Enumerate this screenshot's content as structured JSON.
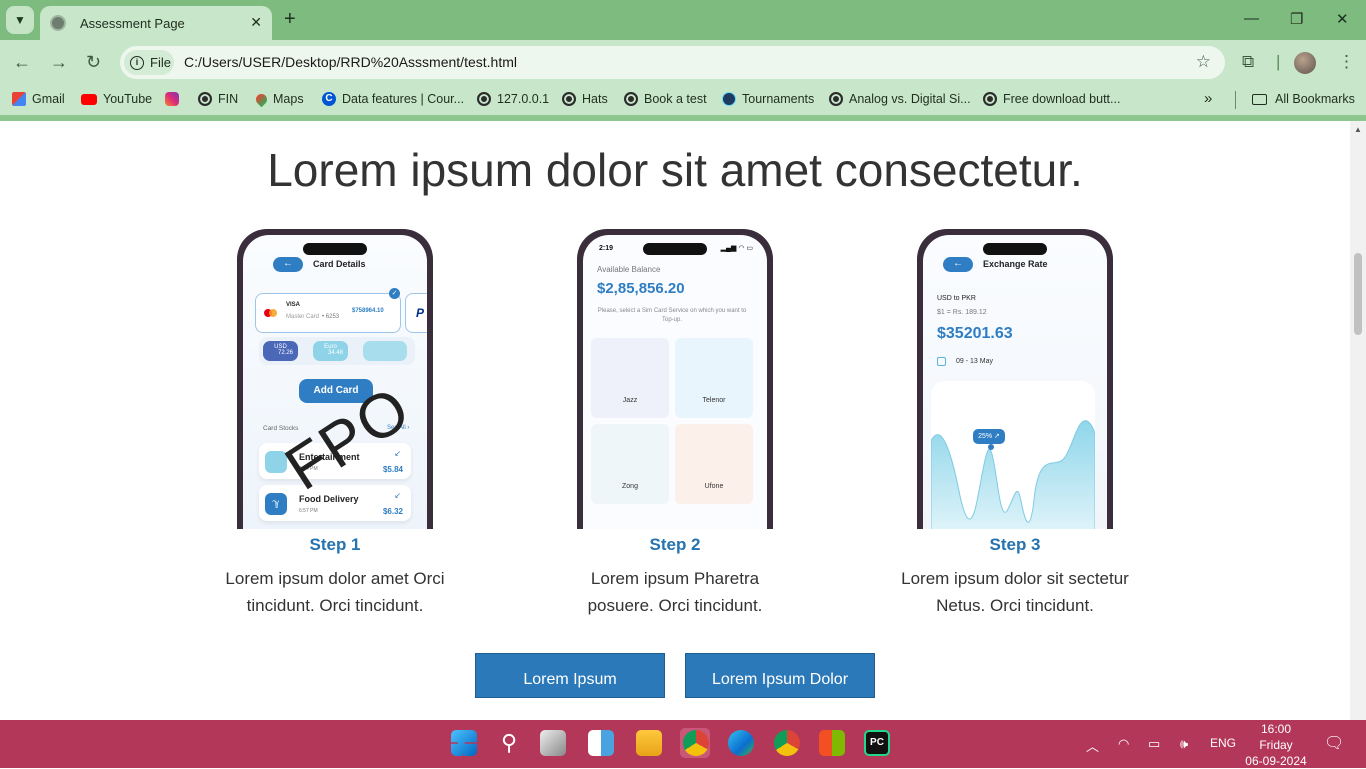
{
  "browser": {
    "tab_title": "Assessment Page",
    "new_tab": "+",
    "file_chip": "File",
    "url": "C:/Users/USER/Desktop/RRD%20Asssment/test.html",
    "bookmarks": [
      {
        "label": "Gmail",
        "icon": "gmail-icon"
      },
      {
        "label": "YouTube",
        "icon": "youtube-icon"
      },
      {
        "label": "",
        "icon": "instagram-icon"
      },
      {
        "label": "FIN",
        "icon": "globe-icon"
      },
      {
        "label": "Maps",
        "icon": "maps-icon"
      },
      {
        "label": "Data features | Cour...",
        "icon": "coursera-icon"
      },
      {
        "label": "127.0.0.1",
        "icon": "globe-icon"
      },
      {
        "label": "Hats",
        "icon": "globe-icon"
      },
      {
        "label": "Book a test",
        "icon": "globe-icon"
      },
      {
        "label": "Tournaments",
        "icon": "react-icon"
      },
      {
        "label": "Analog vs. Digital Si...",
        "icon": "globe-icon"
      },
      {
        "label": "Free download butt...",
        "icon": "globe-icon"
      }
    ],
    "more_bookmarks": "»",
    "all_bookmarks": "All Bookmarks"
  },
  "page": {
    "heading": "Lorem ipsum dolor sit amet consectetur.",
    "steps": [
      {
        "title": "Step 1",
        "desc_line1": "Lorem ipsum dolor amet Orci",
        "desc_line2": "tincidunt. Orci tincidunt."
      },
      {
        "title": "Step 2",
        "desc_line1": "Lorem ipsum Pharetra",
        "desc_line2": "posuere. Orci tincidunt."
      },
      {
        "title": "Step 3",
        "desc_line1": "Lorem ipsum dolor sit sectetur",
        "desc_line2": "Netus. Orci tincidunt."
      }
    ],
    "buttons": {
      "primary": "Lorem Ipsum",
      "secondary": "Lorem Ipsum Dolor"
    }
  },
  "phone1": {
    "title": "Card Details",
    "card_brand": "VISA",
    "card_type": "Master Card",
    "card_number": "• 6253",
    "card_amount": "$758964.10",
    "currencies": [
      {
        "code": "USD",
        "value": "72.26"
      },
      {
        "code": "Euro",
        "value": "34.48"
      },
      {
        "code": "",
        "value": ""
      }
    ],
    "add_card": "Add Card",
    "section_label": "Card Stocks",
    "see_all": "See All ›",
    "watermark": "FPO",
    "transactions": [
      {
        "name": "Entertainment",
        "time": "4:34 PM",
        "amount": "$5.84"
      },
      {
        "name": "Food Delivery",
        "time": "6:57 PM",
        "amount": "$6.32"
      }
    ]
  },
  "phone2": {
    "time": "2:19",
    "label": "Available Balance",
    "balance": "$2,85,856.20",
    "note": "Please, select a Sim Card Service on which you want to Top-up.",
    "sims": [
      "Jazz",
      "Telenor",
      "Zong",
      "Ufone"
    ]
  },
  "phone3": {
    "title": "Exchange Rate",
    "pair": "USD to PKR",
    "rate": "$1 = Rs. 189.12",
    "amount": "$35201.63",
    "dates": "09 - 13 May",
    "badge": "25% ↗"
  },
  "taskbar": {
    "language": "ENG",
    "time": "16:00",
    "day": "Friday",
    "date": "06-09-2024"
  },
  "colors": {
    "accent": "#2b79b8",
    "browser_frame": "#8cc78f",
    "taskbar": "#b33759"
  }
}
